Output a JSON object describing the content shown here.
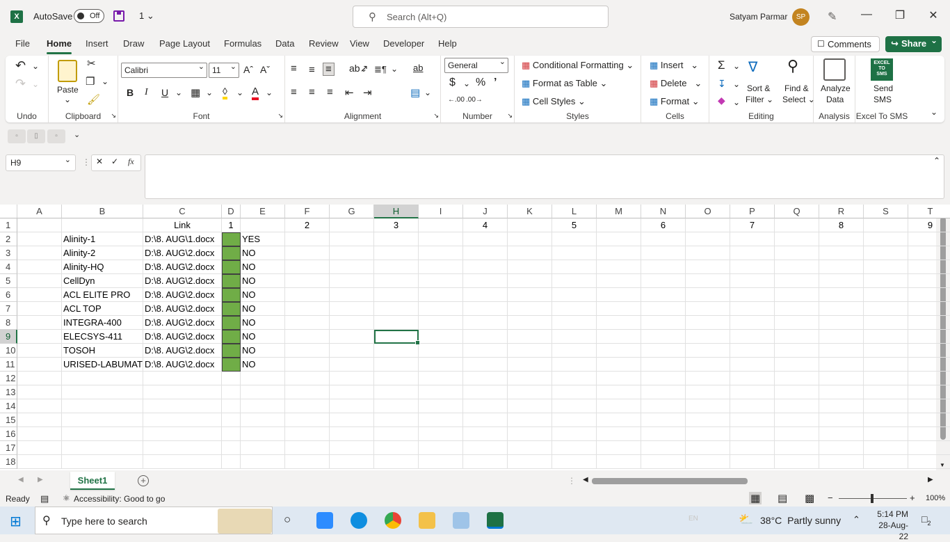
{
  "titlebar": {
    "app_icon": "excel-icon",
    "autosave_label": "AutoSave",
    "autosave_state": "Off",
    "undo_count": "1",
    "search_placeholder": "Search (Alt+Q)",
    "user_name": "Satyam Parmar",
    "user_initials": "SP"
  },
  "menu": {
    "tabs": [
      "File",
      "Home",
      "Insert",
      "Draw",
      "Page Layout",
      "Formulas",
      "Data",
      "Review",
      "View",
      "Developer",
      "Help"
    ],
    "active_tab": "Home",
    "comments_label": "Comments",
    "share_label": "Share"
  },
  "ribbon": {
    "undo_group": "Undo",
    "clipboard_group": "Clipboard",
    "paste_label": "Paste",
    "font_group": "Font",
    "font_name": "Calibri",
    "font_size": "11",
    "alignment_group": "Alignment",
    "number_group": "Number",
    "number_format": "General",
    "styles_group": "Styles",
    "conditional_formatting": "Conditional Formatting",
    "format_as_table": "Format as Table",
    "cell_styles": "Cell Styles",
    "cells_group": "Cells",
    "insert_label": "Insert",
    "delete_label": "Delete",
    "format_label": "Format",
    "editing_group": "Editing",
    "sort_filter_1": "Sort &",
    "sort_filter_2": "Filter",
    "find_select_1": "Find &",
    "find_select_2": "Select",
    "analysis_group": "Analysis",
    "analyze_data_1": "Analyze",
    "analyze_data_2": "Data",
    "sms_group": "Excel To SMS",
    "send_sms_1": "Send",
    "send_sms_2": "SMS",
    "sms_logo_1": "EXCEL",
    "sms_logo_2": "TO",
    "sms_logo_3": "SMS"
  },
  "formula_bar": {
    "name_box": "H9",
    "fx_label": "fx",
    "formula": ""
  },
  "sheet": {
    "columns": [
      "A",
      "B",
      "C",
      "D",
      "E",
      "F",
      "G",
      "H",
      "I",
      "J",
      "K",
      "L",
      "M",
      "N",
      "O",
      "P",
      "Q",
      "R",
      "S",
      "T"
    ],
    "selected_column": "H",
    "selected_row": 9,
    "rows": [
      "1",
      "2",
      "3",
      "4",
      "5",
      "6",
      "7",
      "8",
      "9",
      "10",
      "11",
      "12",
      "13",
      "14",
      "15",
      "16",
      "17",
      "18"
    ],
    "header_row": {
      "C": "Link",
      "D": "1",
      "F": "2",
      "H": "3",
      "J": "4",
      "L": "5",
      "N": "6",
      "P": "7",
      "R": "8",
      "T": "9"
    },
    "data_rows": [
      {
        "name": "Alinity-1",
        "link": "D:\\8. AUG\\1.docx",
        "flag": "YES"
      },
      {
        "name": "Alinity-2",
        "link": "D:\\8. AUG\\2.docx",
        "flag": "NO"
      },
      {
        "name": "Alinity-HQ",
        "link": "D:\\8. AUG\\2.docx",
        "flag": "NO"
      },
      {
        "name": "CellDyn",
        "link": "D:\\8. AUG\\2.docx",
        "flag": "NO"
      },
      {
        "name": "ACL ELITE PRO",
        "link": "D:\\8. AUG\\2.docx",
        "flag": "NO"
      },
      {
        "name": "ACL TOP",
        "link": "D:\\8. AUG\\2.docx",
        "flag": "NO"
      },
      {
        "name": "INTEGRA-400",
        "link": "D:\\8. AUG\\2.docx",
        "flag": "NO"
      },
      {
        "name": "ELECSYS-411",
        "link": "D:\\8. AUG\\2.docx",
        "flag": "NO"
      },
      {
        "name": "TOSOH",
        "link": "D:\\8. AUG\\2.docx",
        "flag": "NO"
      },
      {
        "name": "URISED-LABUMAT",
        "link": "D:\\8. AUG\\2.docx",
        "flag": "NO"
      }
    ],
    "fill_color": "#70ad47"
  },
  "sheet_tabs": {
    "active": "Sheet1"
  },
  "status": {
    "ready": "Ready",
    "accessibility": "Accessibility: Good to go",
    "zoom": "100%"
  },
  "taskbar": {
    "search_placeholder": "Type here to search",
    "language": "EN",
    "temperature": "38°C",
    "weather": "Partly sunny",
    "time": "5:14 PM",
    "date": "28-Aug-22",
    "notifications": "2"
  },
  "colors": {
    "accent": "#217346",
    "brand": "#1e7145"
  }
}
